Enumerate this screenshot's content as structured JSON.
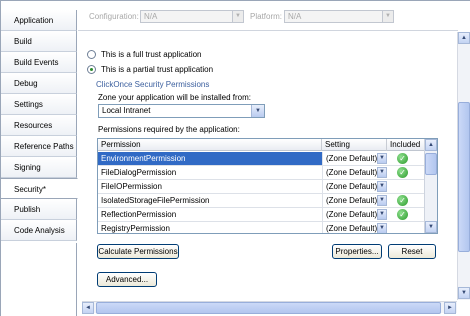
{
  "tabs": [
    {
      "label": "Application"
    },
    {
      "label": "Build"
    },
    {
      "label": "Build Events"
    },
    {
      "label": "Debug"
    },
    {
      "label": "Settings"
    },
    {
      "label": "Resources"
    },
    {
      "label": "Reference Paths"
    },
    {
      "label": "Signing"
    },
    {
      "label": "Security*"
    },
    {
      "label": "Publish"
    },
    {
      "label": "Code Analysis"
    }
  ],
  "selected_tab": "Security*",
  "config_bar": {
    "configuration_label": "Configuration:",
    "configuration_value": "N/A",
    "platform_label": "Platform:",
    "platform_value": "N/A"
  },
  "trust": {
    "full_trust_label": "This is a full trust application",
    "partial_trust_label": "This is a partial trust application",
    "selected": "partial"
  },
  "clickonce_heading": "ClickOnce Security Permissions",
  "zone": {
    "label": "Zone your application will be installed from:",
    "value": "Local Intranet"
  },
  "permissions": {
    "label": "Permissions required by the application:",
    "columns": [
      "Permission",
      "Setting",
      "Included"
    ],
    "rows": [
      {
        "permission": "EnvironmentPermission",
        "setting": "(Zone Default)",
        "included": true,
        "selected": true
      },
      {
        "permission": "FileDialogPermission",
        "setting": "(Zone Default)",
        "included": true,
        "selected": false
      },
      {
        "permission": "FileIOPermission",
        "setting": "(Zone Default)",
        "included": false,
        "selected": false
      },
      {
        "permission": "IsolatedStorageFilePermission",
        "setting": "(Zone Default)",
        "included": true,
        "selected": false
      },
      {
        "permission": "ReflectionPermission",
        "setting": "(Zone Default)",
        "included": true,
        "selected": false
      },
      {
        "permission": "RegistryPermission",
        "setting": "(Zone Default)",
        "included": false,
        "selected": false
      }
    ]
  },
  "buttons": {
    "calculate": "Calculate Permissions",
    "properties": "Properties...",
    "reset": "Reset",
    "advanced": "Advanced..."
  },
  "icons": {
    "dropdown": "▼",
    "up": "▲",
    "down": "▼",
    "left": "◄",
    "right": "►",
    "check": "✓"
  },
  "colors": {
    "selection": "#316ac5",
    "link": "#3b5f9e",
    "check_green": "#2b9a2b"
  }
}
